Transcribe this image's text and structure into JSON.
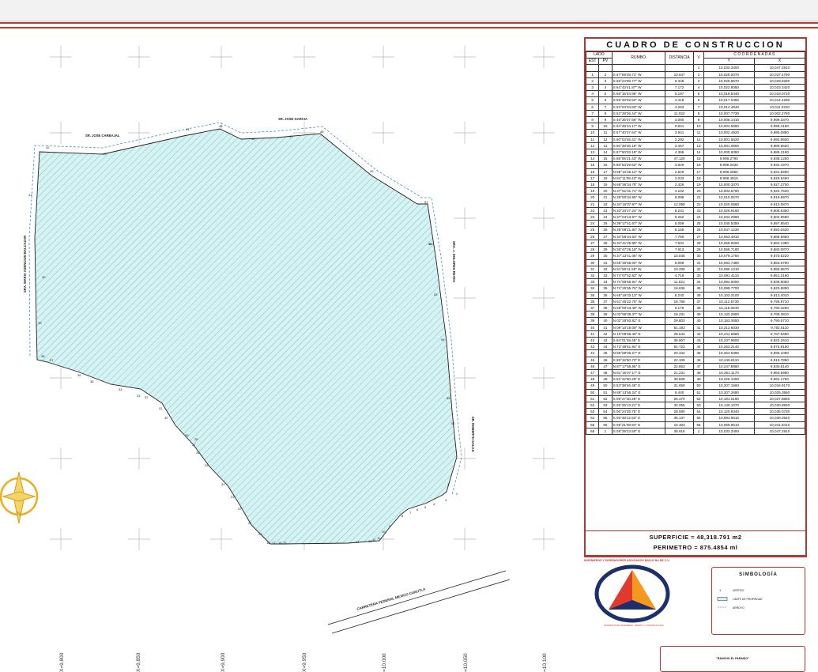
{
  "table": {
    "title": "CUADRO DE CONSTRUCCION",
    "head": {
      "lado": "LADO",
      "est": "EST",
      "pv": "PV",
      "rumbo": "RUMBO",
      "distancia": "DISTANCIA",
      "v": "V",
      "coordenadas": "C O O R D E N A D A S",
      "y": "Y",
      "x": "X"
    },
    "first_row": {
      "v": "1",
      "y": "10,033.3400",
      "x": "10,047.2910"
    },
    "rows": [
      [
        "1",
        "2",
        "S 67°09'29.71\" W",
        "10.647",
        "2",
        "10,029.2070",
        "10,037.4790"
      ],
      [
        "2",
        "3",
        "S 66°24'59.77\" W",
        "8.348",
        "3",
        "10,025.8670",
        "10,029.8280"
      ],
      [
        "3",
        "4",
        "S 64°43'41.87\" W",
        "7.172",
        "4",
        "10,022.8050",
        "10,023.3420"
      ],
      [
        "4",
        "5",
        "S 58°15'04.95\" W",
        "6.197",
        "5",
        "10,019.5440",
        "10,018.0720"
      ],
      [
        "5",
        "6",
        "S 55°33'03.53\" W",
        "4.418",
        "6",
        "10,017.0450",
        "10,014.4290"
      ],
      [
        "6",
        "7",
        "S 53°04'34.83\" W",
        "4.263",
        "7",
        "10,014.4840",
        "10,011.0210"
      ],
      [
        "7",
        "8",
        "S 52°29'26.44\" W",
        "11.022",
        "8",
        "10,007.7730",
        "10,002.2780"
      ],
      [
        "8",
        "9",
        "S 46°35'07.66\" W",
        "4.060",
        "9",
        "10,005.1410",
        "9,999.1870"
      ],
      [
        "9",
        "10",
        "S 54°49'24.17\" W",
        "0.841",
        "10",
        "10,004.5990",
        "9,998.4180"
      ],
      [
        "10",
        "11",
        "S 57°40'37.64\" W",
        "3.941",
        "11",
        "10,002.4920",
        "9,995.0880"
      ],
      [
        "11",
        "12",
        "S 60°03'46.41\" W",
        "2.292",
        "12",
        "10,001.5620",
        "9,992.9930"
      ],
      [
        "12",
        "13",
        "S 60°38'36.19\" W",
        "3.457",
        "13",
        "10,001.0800",
        "9,989.5620"
      ],
      [
        "13",
        "14",
        "S 87°50'03.19\" W",
        "4.366",
        "14",
        "10,000.8350",
        "9,985.2190"
      ],
      [
        "14",
        "15",
        "S 88°06'21.43\" W",
        "47.120",
        "15",
        "9,999.2790",
        "9,938.1250"
      ],
      [
        "15",
        "16",
        "S 88°53'29.63\" W",
        "3.929",
        "16",
        "9,999.2030",
        "9,934.1970"
      ],
      [
        "16",
        "17",
        "N 88°12'46.12\" W",
        "2.629",
        "17",
        "9,999.2850",
        "9,931.5690"
      ],
      [
        "17",
        "18",
        "N 84°11'08.42\" W",
        "2.033",
        "18",
        "9,999.4910",
        "9,929.5460"
      ],
      [
        "18",
        "19",
        "N 69°36'34.78\" W",
        "2.428",
        "19",
        "10,000.3370",
        "9,927.2700"
      ],
      [
        "19",
        "20",
        "N 37°51'01.74\" W",
        "4.102",
        "20",
        "10,003.5780",
        "9,924.7530"
      ],
      [
        "20",
        "21",
        "N 36°50'34.85\" W",
        "8.098",
        "21",
        "10,010.0570",
        "9,919.8970"
      ],
      [
        "21",
        "22",
        "N 34°15'07.97\" W",
        "12.099",
        "22",
        "10,020.0580",
        "9,913.0870"
      ],
      [
        "22",
        "23",
        "N 33°34'27.24\" W",
        "8.231",
        "23",
        "10,026.9160",
        "9,908.5350"
      ],
      [
        "23",
        "24",
        "N 37°04'13.97\" W",
        "9.252",
        "24",
        "10,034.2980",
        "9,902.9580"
      ],
      [
        "24",
        "25",
        "N 39°17'41.67\" W",
        "8.059",
        "25",
        "10,040.5350",
        "9,897.8540"
      ],
      [
        "25",
        "26",
        "N 36°08'21.94\" W",
        "8.158",
        "26",
        "10,047.1230",
        "9,893.0430"
      ],
      [
        "26",
        "27",
        "N 34°58'34.63\" W",
        "7.759",
        "27",
        "10,053.4810",
        "9,888.5850"
      ],
      [
        "27",
        "28",
        "N 34°41'25.89\" W",
        "7.631",
        "28",
        "10,059.9200",
        "9,884.1380"
      ],
      [
        "28",
        "29",
        "N 30°47'26.18\" W",
        "7.913",
        "29",
        "10,066.7180",
        "9,880.0870"
      ],
      [
        "29",
        "30",
        "N 37°13'41.05\" W",
        "15.645",
        "30",
        "10,079.1750",
        "9,870.6220"
      ],
      [
        "30",
        "31",
        "N 55°30'55.00\" W",
        "8.059",
        "31",
        "10,083.7380",
        "9,863.9790"
      ],
      [
        "31",
        "32",
        "N 51°50'11.55\" W",
        "10.330",
        "32",
        "10,090.1210",
        "9,855.8570"
      ],
      [
        "32",
        "33",
        "N 74°07'52.83\" W",
        "4.718",
        "33",
        "10,091.4110",
        "9,851.3190"
      ],
      [
        "33",
        "34",
        "N 74°58'55.94\" W",
        "11.921",
        "34",
        "10,094.5000",
        "9,839.8050"
      ],
      [
        "34",
        "35",
        "N 74°25'55.76\" W",
        "19.636",
        "35",
        "10,099.7700",
        "9,820.8890"
      ],
      [
        "35",
        "36",
        "N 65°19'33.13\" W",
        "8.240",
        "36",
        "10,103.2100",
        "9,813.4010"
      ],
      [
        "36",
        "37",
        "N 61°45'22.75\" W",
        "19.786",
        "37",
        "10,112.5730",
        "9,795.9710"
      ],
      [
        "37",
        "38",
        "N 66°00'43.49\" W",
        "6.176",
        "38",
        "10,115.0840",
        "9,790.3280"
      ],
      [
        "38",
        "39",
        "N 02°58'39.37\" W",
        "18.231",
        "39",
        "10,133.2900",
        "9,789.3810"
      ],
      [
        "39",
        "40",
        "N 02°28'50.82\" E",
        "29.803",
        "40",
        "10,163.0650",
        "9,790.6710"
      ],
      [
        "40",
        "41",
        "N 09°10'19.09\" W",
        "51.193",
        "41",
        "10,213.6030",
        "9,782.5110"
      ],
      [
        "41",
        "42",
        "N 10°09'58.46\" E",
        "28.543",
        "42",
        "10,241.6980",
        "9,787.5490"
      ],
      [
        "42",
        "43",
        "S 84°01'28.45\" E",
        "35.907",
        "43",
        "10,237.9600",
        "9,823.2610"
      ],
      [
        "43",
        "44",
        "N 73°48'51.94\" E",
        "54.723",
        "44",
        "10,253.2140",
        "9,875.8150"
      ],
      [
        "44",
        "45",
        "N 85°59'06.27\" E",
        "20.344",
        "45",
        "10,254.6390",
        "9,896.1090"
      ],
      [
        "45",
        "46",
        "S 69°15'50.73\" E",
        "22.109",
        "46",
        "10,246.8110",
        "9,916.7860"
      ],
      [
        "46",
        "47",
        "N 87°17'55.86\" E",
        "22.853",
        "47",
        "10,247.8880",
        "9,939.6140"
      ],
      [
        "47",
        "48",
        "N 81°15'07.17\" E",
        "21.231",
        "48",
        "10,251.1170",
        "9,960.5980"
      ],
      [
        "48",
        "49",
        "S 52°42'50.26\" E",
        "39.509",
        "49",
        "10,226.1000",
        "9,991.1780"
      ],
      [
        "49",
        "50",
        "S 53°38'46.46\" E",
        "31.659",
        "50",
        "10,207.1560",
        "10,016.9170"
      ],
      [
        "50",
        "51",
        "N 89°13'56.24\" E",
        "8.440",
        "51",
        "10,207.2690",
        "10,025.3560"
      ],
      [
        "51",
        "52",
        "S 09°27'30.28\" E",
        "26.370",
        "52",
        "10,181.0190",
        "10,027.8650"
      ],
      [
        "52",
        "53",
        "S 05°25'13.21\" E",
        "32.055",
        "53",
        "10,149.1070",
        "10,030.8930"
      ],
      [
        "53",
        "54",
        "S 06°24'35.75\" E",
        "28.580",
        "54",
        "10,120.8340",
        "10,035.0730"
      ],
      [
        "54",
        "55",
        "S 06°48'12.53\" E",
        "36.137",
        "55",
        "10,084.9510",
        "10,039.3540"
      ],
      [
        "55",
        "56",
        "S 09°21'09.94\" E",
        "15.303",
        "56",
        "10,069.8510",
        "10,041.8410"
      ],
      [
        "56",
        "1",
        "S 08°29'23.50\" E",
        "36.916",
        "1",
        "10,033.3400",
        "10,047.2910"
      ]
    ],
    "superficie": "SUPERFICIE = 48,318.791 m2",
    "perimetro": "PERIMETRO = 875.4854 ml"
  },
  "plan": {
    "owners": {
      "north_1": "SR. JOSE CARBAJAL",
      "north_2": "SR. JOSE GARCIA",
      "west": "SRA. MARIA ASENCION BALCAZAR",
      "east_1": "SRA. J. DOLORES REYES",
      "east_2": "SR. ROBERTO SALAS",
      "road": "CARRETERA FEDERAL MEXICO CUAUTLA"
    },
    "vertex_labels": [
      {
        "id": "1",
        "t": "1"
      },
      {
        "id": "2",
        "t": "2"
      },
      {
        "id": "3",
        "t": "3"
      },
      {
        "id": "4",
        "t": "4"
      },
      {
        "id": "5",
        "t": "5"
      },
      {
        "id": "6",
        "t": "6"
      },
      {
        "id": "7",
        "t": "7"
      },
      {
        "id": "8",
        "t": "8"
      },
      {
        "id": "9",
        "t": "9"
      },
      {
        "id": "10",
        "t": "10"
      },
      {
        "id": "11",
        "t": "11"
      },
      {
        "id": "12",
        "t": "12"
      },
      {
        "id": "13",
        "t": "13"
      },
      {
        "id": "14",
        "t": "14"
      },
      {
        "id": "15",
        "t": "15"
      },
      {
        "id": "16",
        "t": "16"
      },
      {
        "id": "17",
        "t": "17"
      },
      {
        "id": "18",
        "t": "18"
      },
      {
        "id": "20",
        "t": "20"
      },
      {
        "id": "21",
        "t": "21"
      },
      {
        "id": "22",
        "t": "22"
      },
      {
        "id": "23",
        "t": "23"
      },
      {
        "id": "24",
        "t": "24"
      },
      {
        "id": "25",
        "t": "25"
      },
      {
        "id": "26",
        "t": "26"
      },
      {
        "id": "27",
        "t": "27"
      },
      {
        "id": "28",
        "t": "28"
      },
      {
        "id": "29",
        "t": "29"
      },
      {
        "id": "30",
        "t": "30"
      },
      {
        "id": "31",
        "t": "31"
      },
      {
        "id": "32",
        "t": "32"
      },
      {
        "id": "33",
        "t": "33"
      },
      {
        "id": "34",
        "t": "34"
      },
      {
        "id": "35",
        "t": "35"
      },
      {
        "id": "36",
        "t": "36"
      },
      {
        "id": "37",
        "t": "37"
      },
      {
        "id": "38",
        "t": "38"
      },
      {
        "id": "39",
        "t": "39"
      },
      {
        "id": "40",
        "t": "40"
      },
      {
        "id": "41",
        "t": "41"
      },
      {
        "id": "42",
        "t": "42"
      },
      {
        "id": "43",
        "t": "43"
      },
      {
        "id": "44",
        "t": "44"
      },
      {
        "id": "45",
        "t": "45"
      },
      {
        "id": "46",
        "t": "46"
      },
      {
        "id": "47",
        "t": "47"
      },
      {
        "id": "48",
        "t": "48"
      },
      {
        "id": "49",
        "t": "49"
      },
      {
        "id": "50",
        "t": "50"
      },
      {
        "id": "51",
        "t": "51"
      },
      {
        "id": "52",
        "t": "52"
      },
      {
        "id": "53",
        "t": "53"
      },
      {
        "id": "54",
        "t": "54"
      },
      {
        "id": "55",
        "t": "55"
      },
      {
        "id": "56",
        "t": "56"
      }
    ],
    "axis_labels": [
      "X=9,800",
      "X=9,850",
      "X=9,900",
      "X=9,950",
      "=10,000",
      "=10,050",
      "=10,100"
    ],
    "colors": {
      "fill": "#d6f2f2",
      "hatch": "#5fb7bd",
      "boundary": "#222222",
      "arroyo": "#4a90c8",
      "accent": "#c0392b",
      "compass": "#e8b020"
    },
    "compass_label": "N"
  },
  "company": {
    "name": "INGENIEROS Y DISEÑADORES ASOCIADOS BAYLE BA DE C.V.",
    "tagline": "EXPERTOS EN INGENIERIA, DISEÑO Y CONSTRUCCION"
  },
  "legend": {
    "title": "SIMBOLOGÍA",
    "items": [
      "VERTICE",
      "LIMITE DE PROPIEDAD",
      "ARROYO"
    ]
  },
  "project_name": "\"RANCHO EL PARAISO\""
}
